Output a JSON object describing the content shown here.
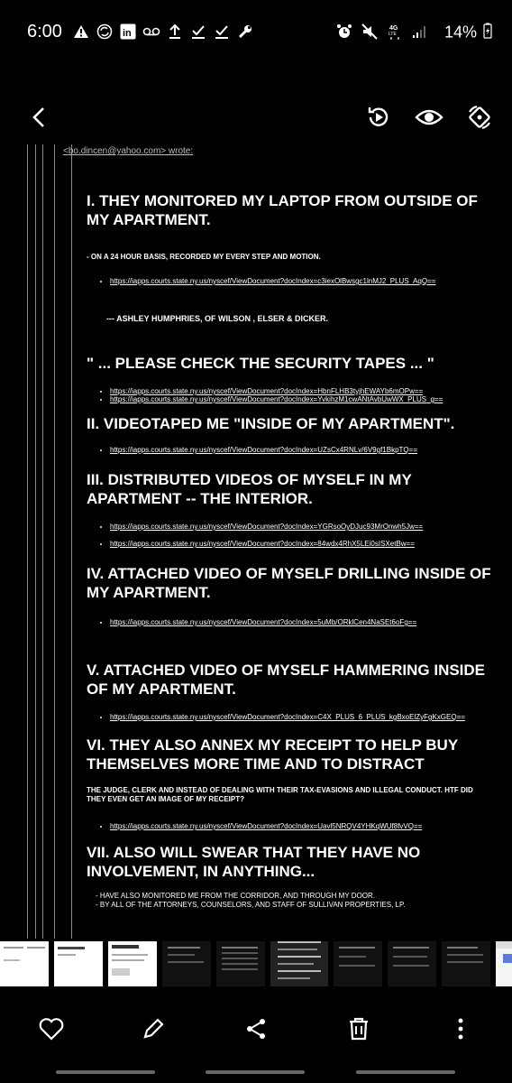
{
  "status": {
    "time": "6:00",
    "battery": "14%",
    "icons_left": [
      "alert-icon",
      "sync-icon",
      "linkedin-icon",
      "voicemail-icon",
      "upload-icon",
      "check-icon",
      "check-icon",
      "wrench-icon"
    ],
    "icons_right": [
      "alarm-icon",
      "mute-icon",
      "4g-lte-icon",
      "signal-icon"
    ]
  },
  "topbar": {
    "actions": [
      "rotate-play-icon",
      "eye-icon",
      "rotate-lock-icon"
    ]
  },
  "email": {
    "quoted_header": "<bo.dincen@yahoo.com> wrote:",
    "sections": [
      {
        "heading": "I.    THEY MONITORED MY LAPTOP FROM OUTSIDE OF MY APARTMENT."
      },
      {
        "text": "- ON A 24 HOUR BASIS, RECORDED MY EVERY STEP AND MOTION."
      },
      {
        "links": [
          "https://iapps.courts.state.ny.us/nyscef/ViewDocument?docIndex=c3iexOlBwsgc1lnMJ2_PLUS_AqQ=="
        ]
      },
      {
        "text": "--- ASHLEY HUMPHRIES, OF WILSON , ELSER & DICKER."
      },
      {
        "heading": "\" ... PLEASE CHECK THE SECURITY TAPES ... \""
      },
      {
        "links": [
          "https://iapps.courts.state.ny.us/nyscef/ViewDocument?docIndex=HbnFLHB3tyjhEWAYb6mOPw==",
          "https://iapps.courts.state.ny.us/nyscef/ViewDocument?docIndex=YvkihzM1cwANtAvbUwWX_PLUS_g=="
        ]
      },
      {
        "heading": "II.    VIDEOTAPED ME \"INSIDE OF MY APARTMENT\"."
      },
      {
        "links": [
          "https://iapps.courts.state.ny.us/nyscef/ViewDocument?docIndex=UZsCx4RNLv/6V9gf1BkpTQ=="
        ]
      },
      {
        "heading": "III.    DISTRIBUTED VIDEOS OF MYSELF IN MY APARTMENT -- THE INTERIOR."
      },
      {
        "links": [
          "https://iapps.courts.state.ny.us/nyscef/ViewDocument?docIndex=YGRsoOyDJuc93MrOnwh5Jw==",
          "https://iapps.courts.state.ny.us/nyscef/ViewDocument?docIndex=84wdx4RhX5LEi0sISXetBw=="
        ]
      },
      {
        "heading": "IV.    ATTACHED VIDEO OF MYSELF DRILLING INSIDE OF MY APARTMENT."
      },
      {
        "links": [
          "https://iapps.courts.state.ny.us/nyscef/ViewDocument?docIndex=5uMb/ORklCen4NaSEt6oFg=="
        ]
      },
      {
        "heading": "V.    ATTACHED VIDEO OF MYSELF HAMMERING INSIDE OF MY APARTMENT."
      },
      {
        "links": [
          "https://iapps.courts.state.ny.us/nyscef/ViewDocument?docIndex=C4X_PLUS_6_PLUS_kgBxoElZyFgKxGEQ=="
        ]
      },
      {
        "heading": "VI.    THEY ALSO ANNEX MY RECEIPT TO HELP BUY THEMSELVES MORE TIME AND TO DISTRACT"
      },
      {
        "text": "THE JUDGE, CLERK AND INSTEAD OF DEALING WITH THEIR TAX-EVASIONS AND ILLEGAL CONDUCT. HTF DID THEY EVEN GET AN IMAGE OF MY RECEIPT?"
      },
      {
        "links": [
          "https://iapps.courts.state.ny.us/nyscef/ViewDocument?docIndex=Uavl5NRQV4YHKqWUf8fvVQ=="
        ]
      },
      {
        "heading": "VII.    ALSO WILL SWEAR THAT THEY HAVE NO INVOLVEMENT, IN ANYTHING..."
      },
      {
        "text": "- HAVE ALSO MONITORED ME FROM THE CORRIDOR, AND THROUGH MY DOOR."
      },
      {
        "text": "- BY ALL OF THE ATTORNEYS, COUNSELORS, AND STAFF OF SULLIVAN PROPERTIES, LP."
      }
    ]
  },
  "filmstrip": {
    "count": 10
  },
  "bottom_bar": [
    "heart-icon",
    "edit-icon",
    "share-icon",
    "delete-icon",
    "more-icon"
  ]
}
